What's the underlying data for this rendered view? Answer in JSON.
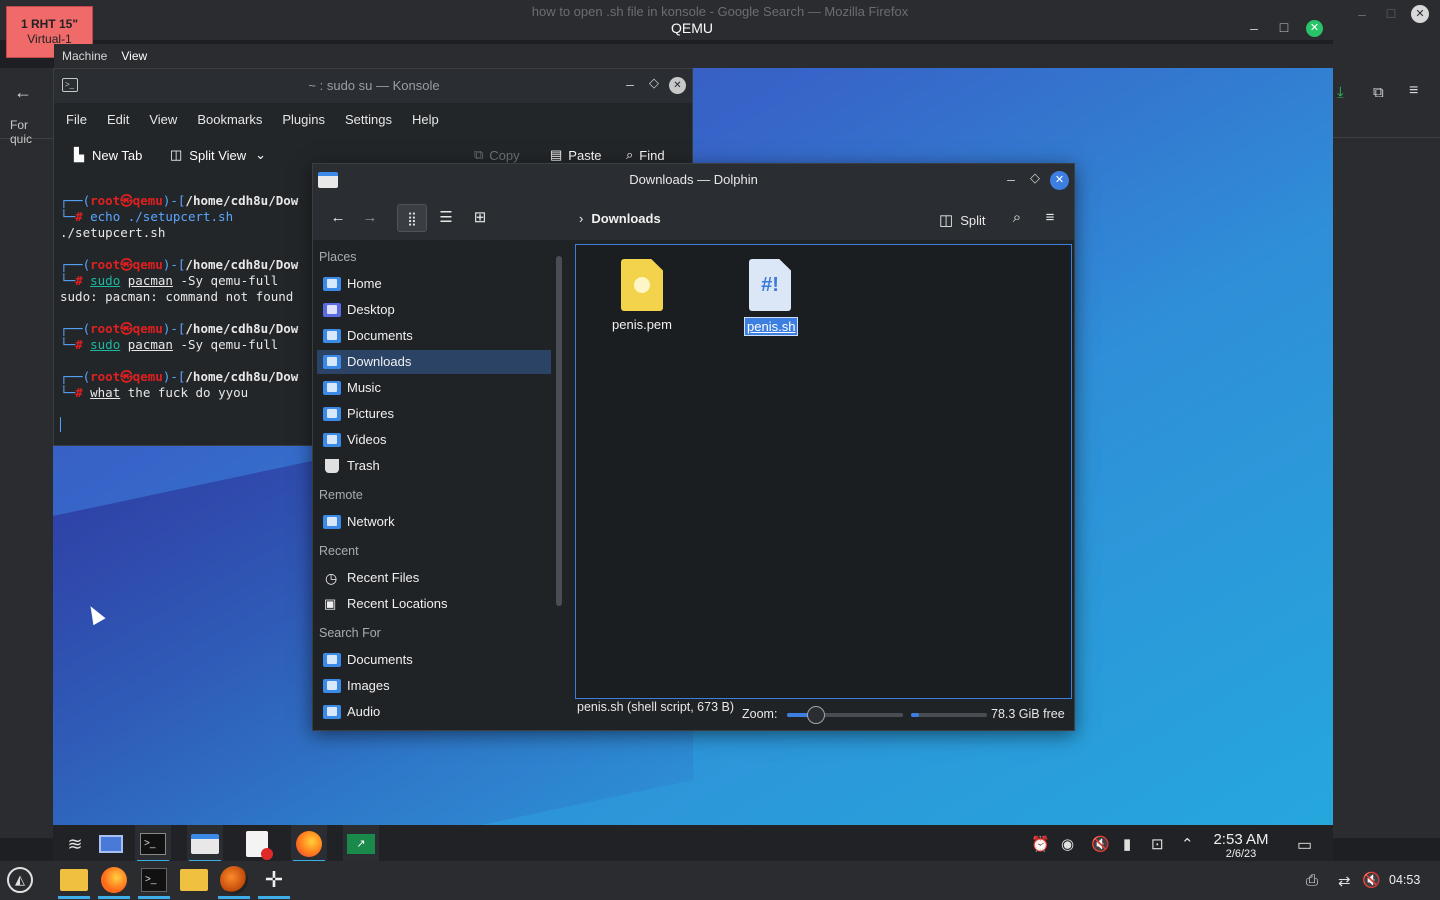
{
  "host": {
    "background_window_title": "how to open .sh file in konsole - Google Search — Mozilla Firefox",
    "qemu_title": "QEMU",
    "badge_line1": "1 RHT 15\"",
    "badge_line2": "Virtual-1",
    "menu": [
      "Machine",
      "View"
    ],
    "firefox_partial_text": "For quic",
    "clock": "04:53"
  },
  "konsole": {
    "title": "~ : sudo su — Konsole",
    "menu": [
      "File",
      "Edit",
      "View",
      "Bookmarks",
      "Plugins",
      "Settings",
      "Help"
    ],
    "toolbar": {
      "new_tab": "New Tab",
      "split_view": "Split View",
      "copy": "Copy",
      "paste": "Paste",
      "find": "Find"
    },
    "prompt_user": "root",
    "prompt_host": "qemu",
    "prompt_path": "/home/cdh8u/Dow",
    "lines": {
      "c1": "echo ./setupcert.sh",
      "o1": "./setupcert.sh",
      "c2_cmd": "sudo",
      "c2_pkg": "pacman",
      "c2_rest": "-Sy qemu-full",
      "o2": "sudo: pacman: command not found",
      "c4_first": "what",
      "c4_rest": "the fuck do yyou"
    }
  },
  "dolphin": {
    "title": "Downloads — Dolphin",
    "breadcrumb": "Downloads",
    "split_label": "Split",
    "places": {
      "places_header": "Places",
      "places_items": [
        "Home",
        "Desktop",
        "Documents",
        "Downloads",
        "Music",
        "Pictures",
        "Videos",
        "Trash"
      ],
      "remote_header": "Remote",
      "remote_items": [
        "Network"
      ],
      "recent_header": "Recent",
      "recent_items": [
        "Recent Files",
        "Recent Locations"
      ],
      "search_header": "Search For",
      "search_items": [
        "Documents",
        "Images",
        "Audio"
      ]
    },
    "selected_place": "Downloads",
    "files": [
      {
        "name": "penis.pem",
        "icon": "certificate-file-icon",
        "selected": false
      },
      {
        "name": "penis.sh",
        "icon": "shell-script-icon",
        "selected": true
      }
    ],
    "status": {
      "selection_info": "penis.sh (shell script, 673 B)",
      "zoom_label": "Zoom:",
      "zoom_level": 0.25,
      "free_space": "78.3 GiB free",
      "free_space_used_fraction": 0.1
    }
  },
  "guest_panel": {
    "time": "2:53 AM",
    "date": "2/6/23"
  },
  "colors": {
    "accent": "#3daee9",
    "selection": "#2b4466",
    "close_button": "#3d7fe0"
  }
}
